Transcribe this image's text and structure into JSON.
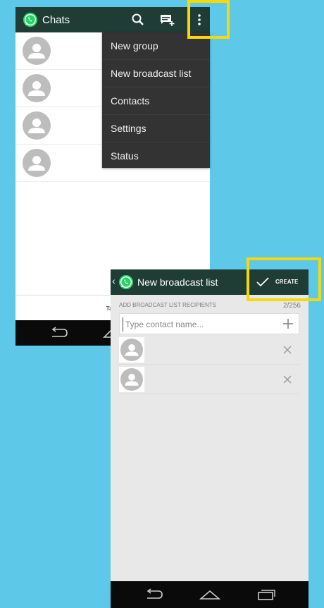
{
  "colors": {
    "background": "#5dc8e8",
    "action_bar": "#1f3c35",
    "menu": "#333333",
    "highlight": "#f5d90e",
    "whatsapp_green": "#25d366"
  },
  "chats_screen": {
    "title": "Chats",
    "icons": [
      "whatsapp-logo-icon",
      "search-icon",
      "new-chat-icon",
      "overflow-menu-icon"
    ],
    "chat_rows": 4,
    "footer_hint": "Tap and hold on a c",
    "menu": {
      "items": [
        {
          "label": "New group"
        },
        {
          "label": "New broadcast list"
        },
        {
          "label": "Contacts"
        },
        {
          "label": "Settings"
        },
        {
          "label": "Status"
        }
      ]
    }
  },
  "broadcast_screen": {
    "back_glyph": "‹",
    "title": "New broadcast list",
    "create_label": "CREATE",
    "recipients_header": "ADD BROADCAST LIST RECIPIENTS",
    "recipients_count": "2/256",
    "search_placeholder": "Type contact name...",
    "recipients": [
      {
        "remove_icon": "close-icon"
      },
      {
        "remove_icon": "close-icon"
      }
    ]
  },
  "navbar_icons": [
    "back-icon",
    "home-icon",
    "recents-icon"
  ]
}
